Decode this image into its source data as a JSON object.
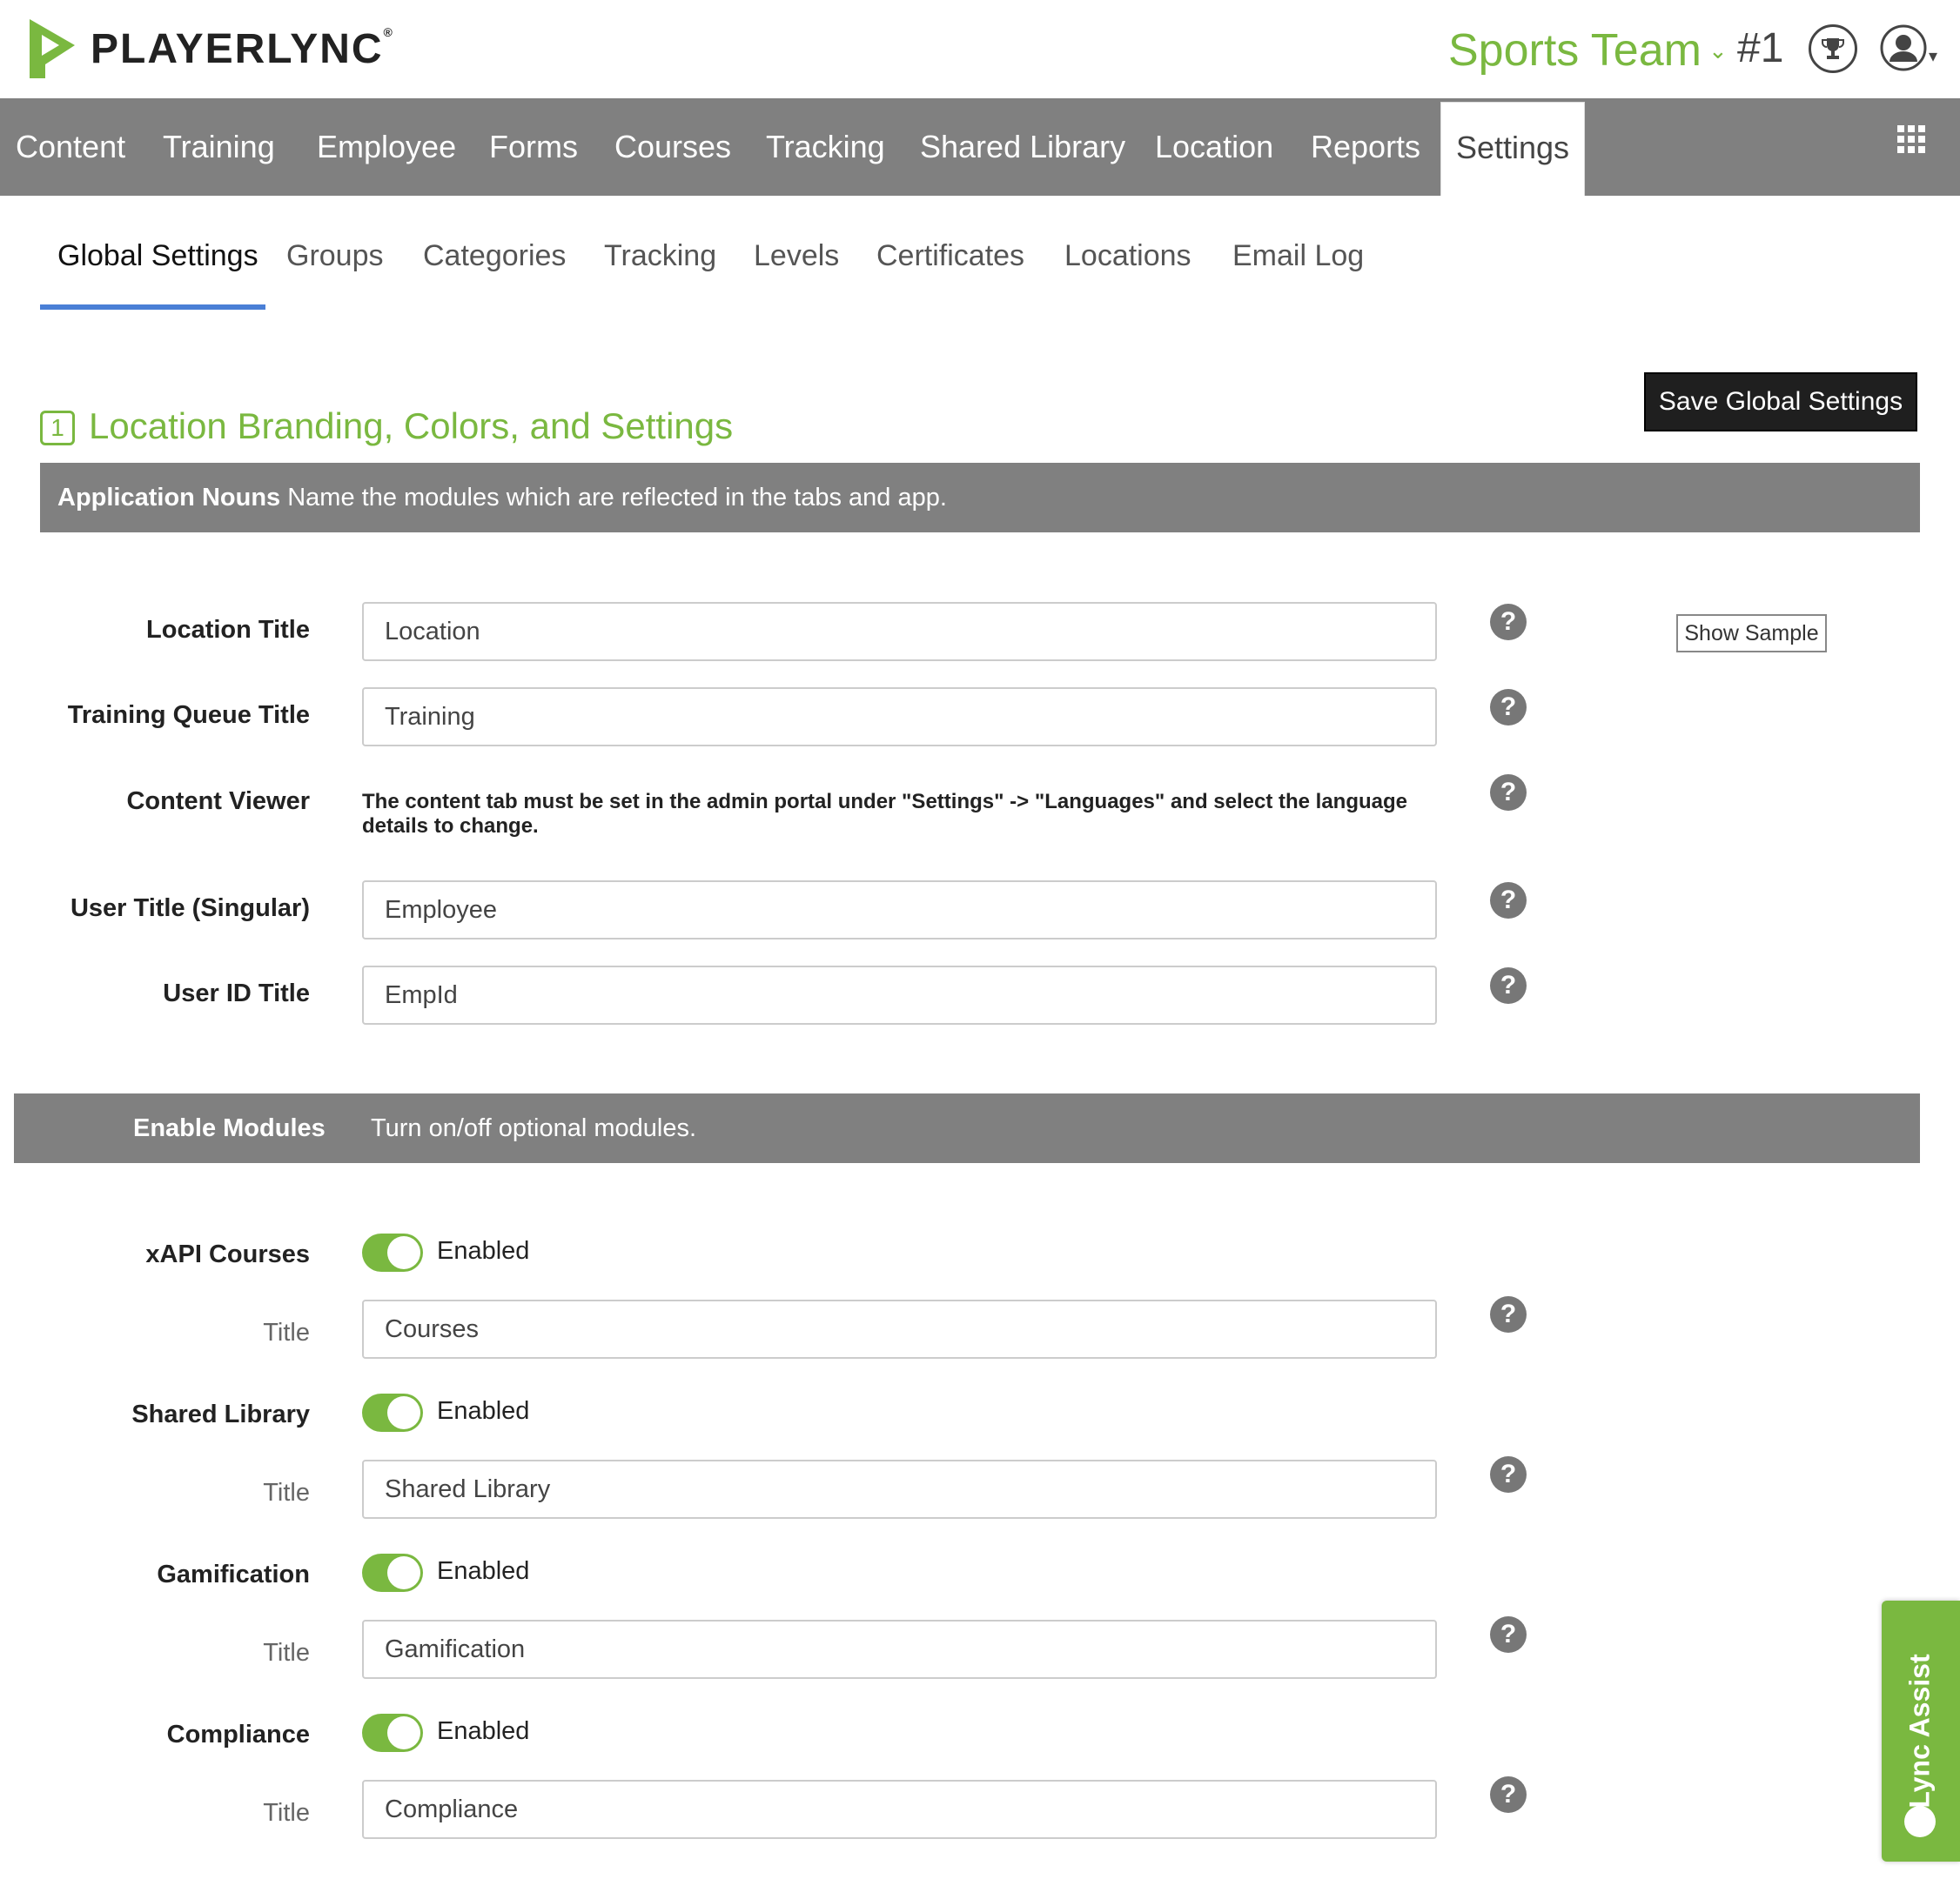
{
  "header": {
    "logo_text": "PLAYERLYNC",
    "logo_reg": "®",
    "team": "Sports Team",
    "rank": "#1"
  },
  "nav": {
    "items": [
      "Content",
      "Training",
      "Employee",
      "Forms",
      "Courses",
      "Tracking",
      "Shared Library",
      "Location",
      "Reports"
    ],
    "active": "Settings"
  },
  "subtabs": {
    "items": [
      "Global Settings",
      "Groups",
      "Categories",
      "Tracking",
      "Levels",
      "Certificates",
      "Locations",
      "Email Log"
    ]
  },
  "section": {
    "number": "1",
    "title": "Location Branding, Colors, and Settings",
    "save_label": "Save Global Settings"
  },
  "nouns_band": {
    "heading": "Application Nouns",
    "description": "Name the modules which are reflected in the tabs and app."
  },
  "nouns": {
    "location_title": {
      "label": "Location Title",
      "value": "Location"
    },
    "training_queue_title": {
      "label": "Training Queue Title",
      "value": "Training"
    },
    "content_viewer": {
      "label": "Content Viewer",
      "note": "The content tab must be set in the admin portal under \"Settings\" -> \"Languages\" and select the language details to change."
    },
    "user_title": {
      "label": "User Title (Singular)",
      "value": "Employee"
    },
    "user_id_title": {
      "label": "User ID Title",
      "value": "EmpId"
    },
    "show_sample": "Show Sample"
  },
  "modules_band": {
    "heading": "Enable Modules",
    "description": "Turn on/off optional modules."
  },
  "modules": {
    "title_label": "Title",
    "enabled_label": "Enabled",
    "xapi": {
      "label": "xAPI Courses",
      "title_value": "Courses"
    },
    "shared_library": {
      "label": "Shared Library",
      "title_value": "Shared Library"
    },
    "gamification": {
      "label": "Gamification",
      "title_value": "Gamification"
    },
    "compliance": {
      "label": "Compliance",
      "title_value": "Compliance"
    }
  },
  "lync_assist": "Lync Assist",
  "colors": {
    "brand_green": "#7ab840",
    "nav_gray": "#808080",
    "accent_blue": "#4a7fd6"
  }
}
